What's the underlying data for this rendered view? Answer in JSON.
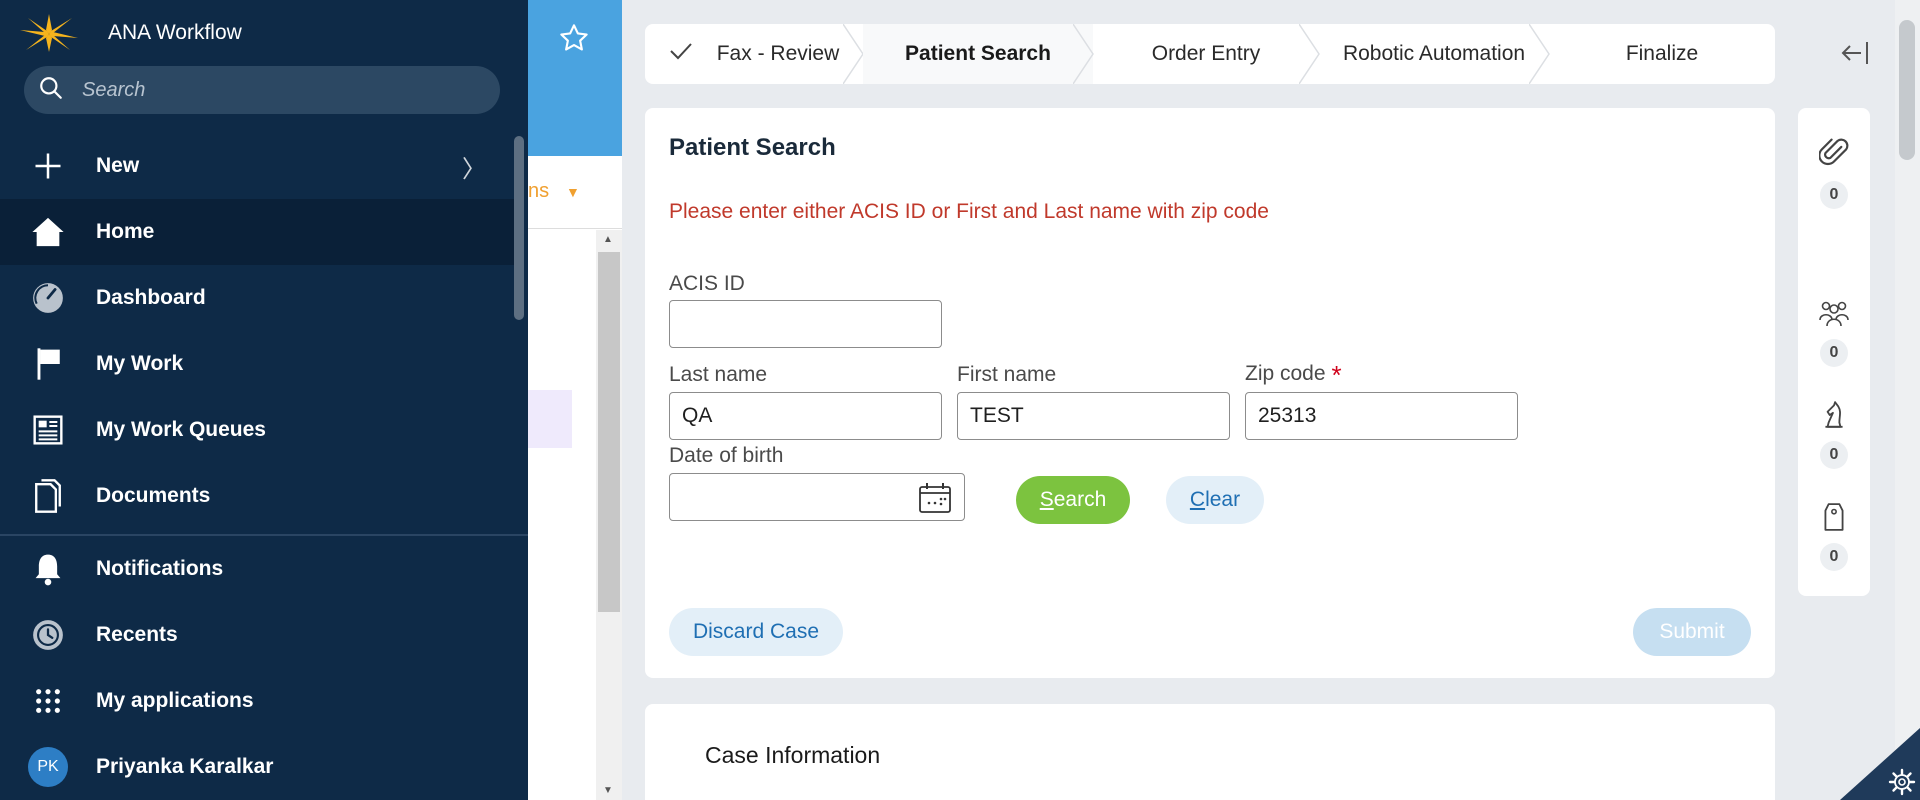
{
  "app": {
    "title": "ANA Workflow"
  },
  "nav": {
    "search_placeholder": "Search",
    "items": [
      {
        "label": "New",
        "icon": "plus-icon",
        "has_submenu": true
      },
      {
        "label": "Home",
        "icon": "home-icon",
        "active": true
      },
      {
        "label": "Dashboard",
        "icon": "dashboard-icon"
      },
      {
        "label": "My Work",
        "icon": "flag-icon"
      },
      {
        "label": "My Work Queues",
        "icon": "queue-icon"
      },
      {
        "label": "Documents",
        "icon": "documents-icon"
      },
      {
        "label": "Notifications",
        "icon": "bell-icon"
      },
      {
        "label": "Recents",
        "icon": "history-icon"
      },
      {
        "label": "My applications",
        "icon": "apps-grid-icon"
      }
    ],
    "user": {
      "initials": "PK",
      "name": "Priyanka Karalkar"
    }
  },
  "background": {
    "partial_label": "ns"
  },
  "stepper": {
    "steps": [
      {
        "label": "Fax - Review",
        "state": "done"
      },
      {
        "label": "Patient Search",
        "state": "current"
      },
      {
        "label": "Order Entry",
        "state": "pending"
      },
      {
        "label": "Robotic Automation",
        "state": "pending"
      },
      {
        "label": "Finalize",
        "state": "pending"
      }
    ]
  },
  "patient_search": {
    "title": "Patient Search",
    "error": "Please enter either ACIS ID or First and Last name with zip code",
    "acis_id": {
      "label": "ACIS ID",
      "value": ""
    },
    "last_name": {
      "label": "Last name",
      "value": "QA"
    },
    "first_name": {
      "label": "First name",
      "value": "TEST"
    },
    "zip_code": {
      "label": "Zip code",
      "value": "25313",
      "required_mark": "*"
    },
    "dob": {
      "label": "Date of birth",
      "value": ""
    },
    "search_button": {
      "accesskey": "S",
      "rest": "earch"
    },
    "clear_button": {
      "accesskey": "C",
      "rest": "lear"
    },
    "discard_button": "Discard Case",
    "submit_button": "Submit"
  },
  "case_info": {
    "title": "Case Information"
  },
  "utility": {
    "items": [
      {
        "icon": "paperclip-icon",
        "count": "0"
      },
      {
        "icon": "people-icon",
        "count": "0"
      },
      {
        "icon": "chess-knight-icon",
        "count": "0"
      },
      {
        "icon": "tag-icon",
        "count": "0"
      }
    ]
  },
  "colors": {
    "nav_bg": "#0e2a47",
    "accent_blue": "#1f6fb3",
    "search_green": "#7cc33f",
    "error_red": "#c0392b"
  }
}
